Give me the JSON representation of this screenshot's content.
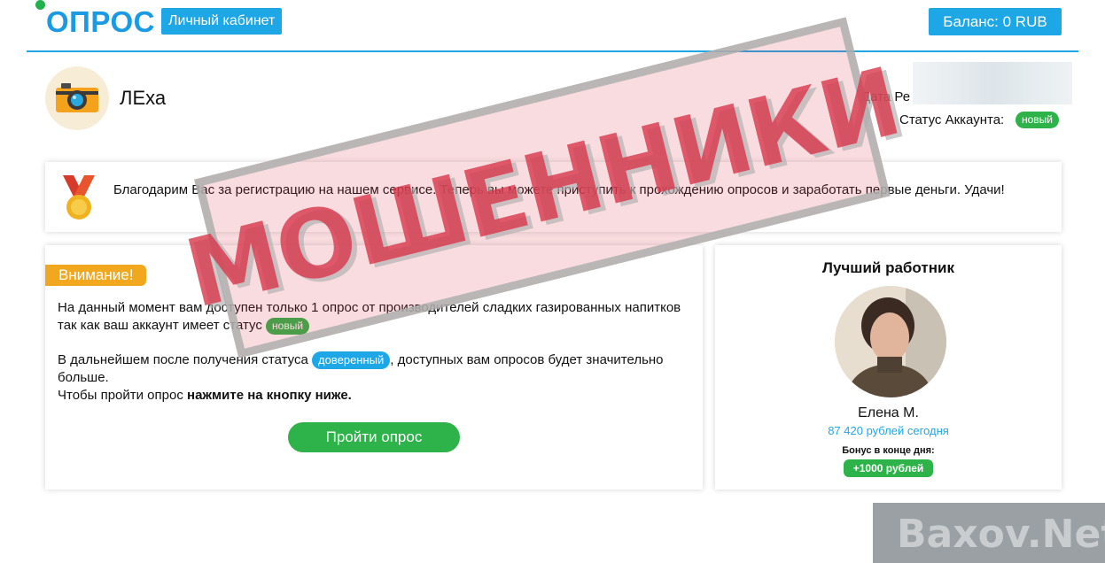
{
  "header": {
    "logo": "ОПРОС",
    "cabinet_label": "Личный кабинет",
    "balance_label": "Баланс: 0 RUB"
  },
  "profile": {
    "username": "ЛЕха",
    "registration_label": "Дата Ре",
    "status_label": "Статус Аккаунта:",
    "status_value": "новый"
  },
  "welcome": {
    "text": "Благодарим Вас за регистрацию на нашем сервисе. Теперь вы можете приступить к прохождению опросов и заработать первые деньги. Удачи!"
  },
  "notice": {
    "attention": "Внимание!",
    "p1_text": "На данный момент вам доступен только 1 опрос от производителей сладких газированных напитков так как ваш аккаунт имеет статус",
    "p1_badge": "новый",
    "p2_before": "В дальнейшем после получения статуса",
    "p2_badge": "доверенный",
    "p2_after": ", доступных вам опросов будет значительно больше.",
    "p3_before": "Чтобы пройти опрос",
    "p3_bold": "нажмите на кнопку ниже.",
    "button": "Пройти опрос"
  },
  "best_worker": {
    "title": "Лучший работник",
    "name": "Елена М.",
    "earnings": "87 420 рублей сегодня",
    "bonus_label": "Бонус в конце дня:",
    "bonus_value": "+1000 рублей"
  },
  "overlay": {
    "stamp": "МОШЕННИКИ",
    "watermark": "Baxov.Net"
  },
  "colors": {
    "accent": "#1ea7e6",
    "green": "#2db34a",
    "orange": "#f2a81e",
    "stamp_red": "#d8374b"
  }
}
